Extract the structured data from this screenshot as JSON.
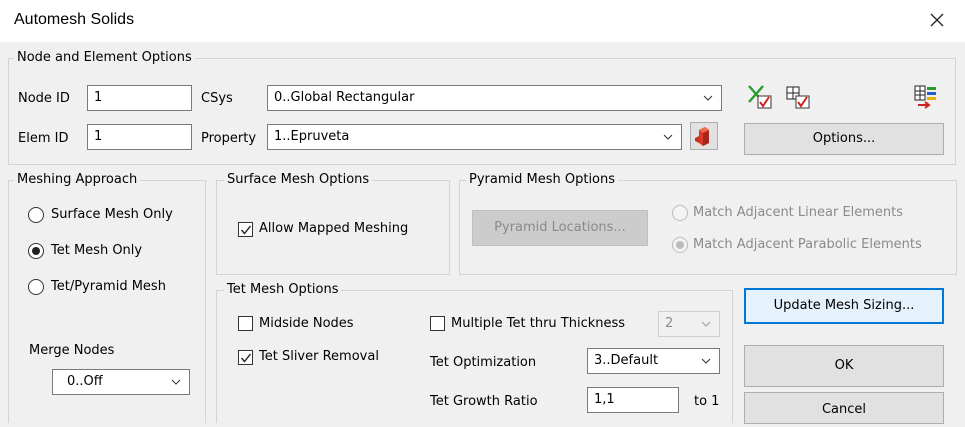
{
  "window": {
    "title": "Automesh Solids"
  },
  "node_element_options": {
    "legend": "Node and Element Options",
    "node_id_label": "Node ID",
    "node_id_value": "1",
    "elem_id_label": "Elem ID",
    "elem_id_value": "1",
    "csys_label": "CSys",
    "csys_value": "0..Global Rectangular",
    "property_label": "Property",
    "property_value": "1..Epruveta",
    "options_button": "Options..."
  },
  "meshing_approach": {
    "legend": "Meshing Approach",
    "options": [
      "Surface Mesh Only",
      "Tet Mesh Only",
      "Tet/Pyramid Mesh"
    ],
    "selected": "Tet Mesh Only",
    "merge_nodes_label": "Merge Nodes",
    "merge_nodes_value": "0..Off"
  },
  "surface_mesh_options": {
    "legend": "Surface Mesh Options",
    "allow_mapped_meshing": {
      "label": "Allow Mapped Meshing",
      "checked": true
    }
  },
  "pyramid_mesh_options": {
    "legend": "Pyramid Mesh Options",
    "locations_button": "Pyramid Locations...",
    "match_linear": "Match Adjacent Linear Elements",
    "match_parabolic": "Match Adjacent Parabolic Elements",
    "selected": "Match Adjacent Parabolic Elements",
    "enabled": false
  },
  "tet_mesh_options": {
    "legend": "Tet Mesh Options",
    "midside_nodes": {
      "label": "Midside Nodes",
      "checked": false
    },
    "tet_sliver_removal": {
      "label": "Tet Sliver Removal",
      "checked": true
    },
    "multiple_tet": {
      "label": "Multiple Tet thru Thickness",
      "checked": false,
      "value": "2"
    },
    "tet_optimization_label": "Tet Optimization",
    "tet_optimization_value": "3..Default",
    "tet_growth_ratio_label": "Tet Growth Ratio",
    "tet_growth_ratio_value": "1,1",
    "to_label": "to 1"
  },
  "buttons": {
    "update_mesh_sizing": "Update Mesh Sizing...",
    "ok": "OK",
    "cancel": "Cancel"
  },
  "icons": {
    "close": "close-icon",
    "toolbar": [
      "select-x-check-icon",
      "grid-check-icon",
      "grid-arrow-icon",
      "property-solid-icon"
    ],
    "accent_green": "#2e9b2e",
    "accent_red": "#d12020"
  }
}
